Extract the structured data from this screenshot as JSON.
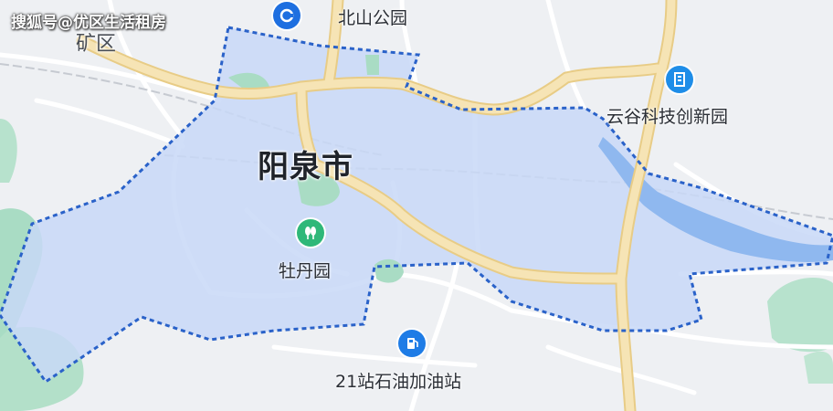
{
  "watermark": "搜狐号@优区生活租房",
  "city_label": "阳泉市",
  "district_label": "矿区",
  "pois": {
    "north_park": "北山公园",
    "tech_park": "云谷科技创新园",
    "peony_garden": "牡丹园",
    "gas_station": "21站石油加油站"
  },
  "colors": {
    "boundary": "#2a62c9",
    "region_fill": "#c8d8f7",
    "road_major": "#f3dfa9",
    "water": "#8fb8ef",
    "park": "#a9dcc4",
    "background": "#eef0f3"
  },
  "icons": {
    "north_park_icon": "subway-icon",
    "tech_park_icon": "building-icon",
    "peony_garden_icon": "park-tree-icon",
    "gas_station_icon": "fuel-icon"
  }
}
